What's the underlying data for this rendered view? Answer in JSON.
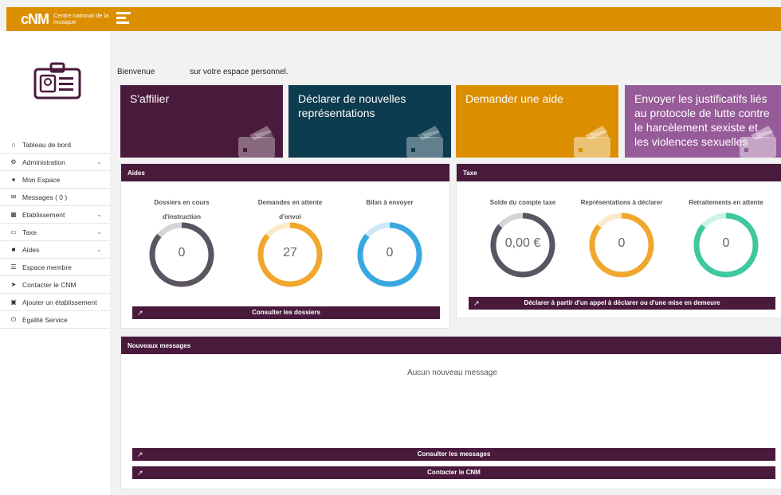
{
  "header": {
    "logo_mark": "cNM",
    "logo_text": "Centre national de la musique",
    "menu_icon": "hamburger-menu-icon"
  },
  "sidebar": {
    "avatar_icon": "id-badge-icon",
    "items": [
      {
        "label": "Tableau de bord",
        "icon": "home-icon",
        "expandable": false
      },
      {
        "label": "Administration",
        "icon": "gear-icon",
        "expandable": true
      },
      {
        "label": "Mon Espace",
        "icon": "user-icon",
        "expandable": false
      },
      {
        "label": "Messages ( 0 )",
        "icon": "envelope-icon",
        "expandable": false
      },
      {
        "label": "Etablissement",
        "icon": "building-icon",
        "expandable": true
      },
      {
        "label": "Taxe",
        "icon": "id-card-icon",
        "expandable": true
      },
      {
        "label": "Aides",
        "icon": "folder-icon",
        "expandable": true
      },
      {
        "label": "Espace membre",
        "icon": "list-icon",
        "expandable": false
      },
      {
        "label": "Contacter le CNM",
        "icon": "paper-plane-icon",
        "expandable": false
      },
      {
        "label": "Ajouter un établissement",
        "icon": "add-building-icon",
        "expandable": false
      },
      {
        "label": "Egalité Service",
        "icon": "power-icon",
        "expandable": false
      }
    ]
  },
  "welcome": {
    "part1": "Bienvenue",
    "part2": "sur votre espace personnel."
  },
  "tiles": [
    {
      "label": "S'affilier",
      "color": "#4a1a3d"
    },
    {
      "label": "Déclarer de nouvelles représentations",
      "color": "#0d3b4f"
    },
    {
      "label": "Demander une aide",
      "color": "#db8e00"
    },
    {
      "label": "Envoyer les justificatifs liés au protocole de lutte contre le harcèlement sexiste et les violences sexuelles",
      "color": "#965b98"
    }
  ],
  "aides": {
    "title": "Aides",
    "stats": [
      {
        "label": "Dossiers en cours d'instruction",
        "value": "0",
        "color": "#5a5560"
      },
      {
        "label": "Demandes en attente d'envoi",
        "value": "27",
        "color": "#f0a72e"
      },
      {
        "label": "Bilan à envoyer",
        "value": "0",
        "color": "#3aa8e0"
      }
    ],
    "button": "Consulter les dossiers"
  },
  "taxe": {
    "title": "Taxe",
    "stats": [
      {
        "label": "Solde du compte taxe",
        "value": "0,00 €",
        "color": "#5a5560"
      },
      {
        "label": "Représentations à déclarer",
        "value": "0",
        "color": "#f0a72e"
      },
      {
        "label": "Retraitements en attente",
        "value": "0",
        "color": "#3fc7a0"
      }
    ],
    "button": "Déclarer à partir d'un appel à déclarer ou d'une mise en demeure"
  },
  "messages": {
    "title": "Nouveaux messages",
    "empty": "Aucun nouveau message",
    "button_consult": "Consulter les messages",
    "button_contact": "Contacter le CNM"
  },
  "colors": {
    "brand": "#db8e00",
    "primary": "#4a1a3d",
    "teal": "#0d3b4f",
    "purple": "#965b98"
  }
}
